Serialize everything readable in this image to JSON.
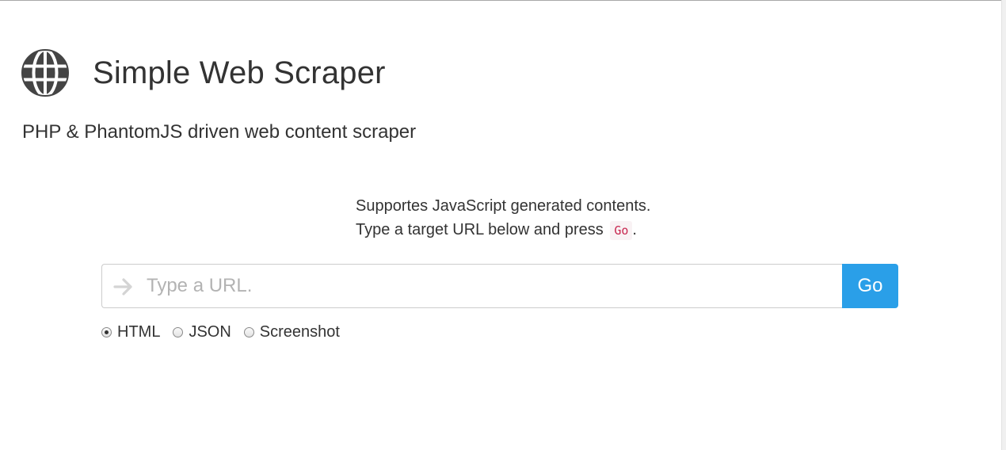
{
  "header": {
    "title": "Simple Web Scraper",
    "subtitle": "PHP & PhantomJS driven web content scraper",
    "icon": "globe-icon"
  },
  "intro": {
    "line1": "Supportes JavaScript generated contents.",
    "line2": "Type a target URL below and press",
    "code": "Go",
    "line2_end": "."
  },
  "search": {
    "placeholder": "Type a URL.",
    "value": "",
    "icon": "arrow-right-icon",
    "button_label": "Go"
  },
  "formats": [
    {
      "label": "HTML",
      "checked": true
    },
    {
      "label": "JSON",
      "checked": false
    },
    {
      "label": "Screenshot",
      "checked": false
    }
  ],
  "colors": {
    "accent": "#2a9fe8",
    "text": "#333333",
    "code": "#c7254e",
    "code_bg": "#f9f2f4",
    "icon": "#444444"
  }
}
